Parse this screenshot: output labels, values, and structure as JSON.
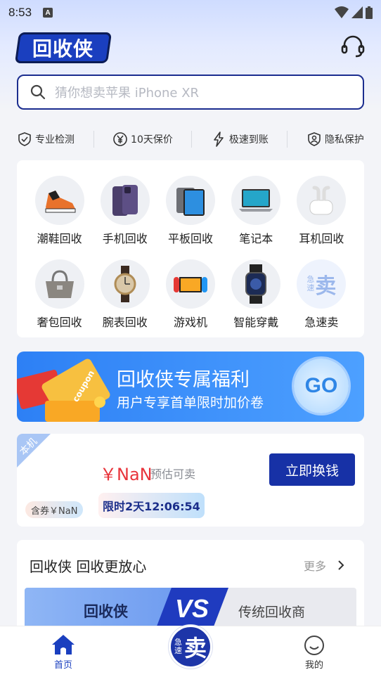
{
  "status_bar": {
    "time": "8:53",
    "notification_icon": "A"
  },
  "header": {
    "logo_text": "回收侠",
    "support_icon": "headset-icon"
  },
  "search": {
    "placeholder": "猜你想卖苹果 iPhone XR"
  },
  "features": [
    {
      "label": "专业检测",
      "icon": "shield-check-icon"
    },
    {
      "label": "10天保价",
      "icon": "yen-circle-icon"
    },
    {
      "label": "极速到账",
      "icon": "lightning-icon"
    },
    {
      "label": "隐私保护",
      "icon": "privacy-shield-icon"
    }
  ],
  "categories": [
    {
      "label": "潮鞋回收",
      "icon": "sneaker-icon"
    },
    {
      "label": "手机回收",
      "icon": "phone-icon"
    },
    {
      "label": "平板回收",
      "icon": "tablet-icon"
    },
    {
      "label": "笔记本",
      "icon": "laptop-icon"
    },
    {
      "label": "耳机回收",
      "icon": "earbuds-icon"
    },
    {
      "label": "奢包回收",
      "icon": "handbag-icon"
    },
    {
      "label": "腕表回收",
      "icon": "watch-icon"
    },
    {
      "label": "游戏机",
      "icon": "game-console-icon"
    },
    {
      "label": "智能穿戴",
      "icon": "smartwatch-icon"
    },
    {
      "label": "急速卖",
      "icon": "quick-sell-icon",
      "icon_text_small": "急速",
      "icon_text_big": "卖"
    }
  ],
  "banner": {
    "title": "回收侠专属福利",
    "subtitle": "用户专享首单限时加价卷",
    "go_label": "GO",
    "art_text": "coupon"
  },
  "estimate": {
    "ribbon": "本机",
    "price": "￥NaN",
    "price_note": "预估可卖",
    "button": "立即换钱",
    "coupon_tag": "含券￥NaN",
    "timer": "限时2天12:06:54"
  },
  "compare": {
    "title": "回收侠 回收更放心",
    "more": "更多",
    "left": "回收侠",
    "vs": "VS",
    "right": "传统回收商"
  },
  "bottom_nav": {
    "home": "首页",
    "center_small": "急速",
    "center_big": "卖",
    "mine": "我的"
  },
  "colors": {
    "brand_blue": "#1a3fbf",
    "price_red": "#e8343b",
    "button_blue": "#1731a6",
    "banner_blue": "#2d80f5"
  }
}
